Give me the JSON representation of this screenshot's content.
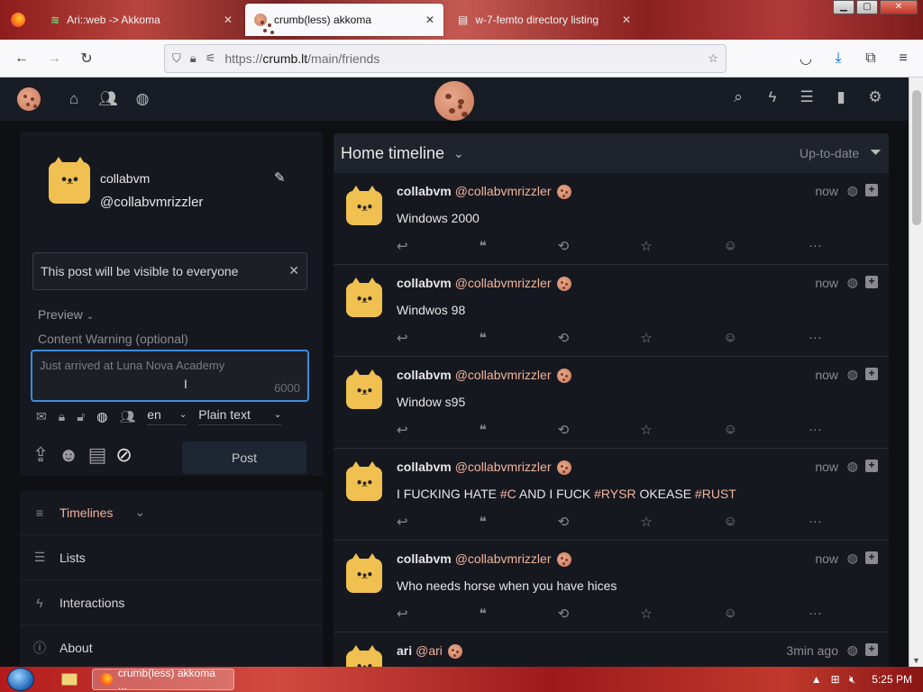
{
  "browser": {
    "tabs": [
      {
        "title": "Ari::web -> Akkoma",
        "active": false
      },
      {
        "title": "crumb(less) akkoma",
        "active": true
      },
      {
        "title": "w-7-femto directory listing",
        "active": false
      }
    ],
    "url": {
      "scheme": "https://",
      "host": "crumb.lt",
      "path": "/main/friends"
    }
  },
  "user": {
    "name": "collabvm",
    "handle": "@collabvmrizzler"
  },
  "composer": {
    "visibility_notice": "This post will be visible to everyone",
    "preview_label": "Preview",
    "cw_placeholder": "Content Warning (optional)",
    "post_placeholder": "Just arrived at Luna Nova Academy",
    "char_count": "6000",
    "language": "en",
    "format": "Plain text",
    "post_button": "Post"
  },
  "menu": {
    "items": [
      {
        "label": "Timelines",
        "icon": "bars-icon",
        "accent": true
      },
      {
        "label": "Lists",
        "icon": "list-icon",
        "accent": false
      },
      {
        "label": "Interactions",
        "icon": "bolt-icon",
        "accent": false
      },
      {
        "label": "About",
        "icon": "info-icon",
        "accent": false
      }
    ]
  },
  "timeline": {
    "title": "Home timeline",
    "status": "Up-to-date",
    "posts": [
      {
        "name": "collabvm",
        "handle": "@collabvmrizzler",
        "time": "now",
        "text": "Windows 2000"
      },
      {
        "name": "collabvm",
        "handle": "@collabvmrizzler",
        "time": "now",
        "text": "Windwos 98"
      },
      {
        "name": "collabvm",
        "handle": "@collabvmrizzler",
        "time": "now",
        "text": "Window s95"
      },
      {
        "name": "collabvm",
        "handle": "@collabvmrizzler",
        "time": "now",
        "text_parts": [
          "I FUCKING HATE ",
          "#C",
          " AND I FUCK ",
          "#RYSR",
          " OKEASE ",
          "#RUST"
        ]
      },
      {
        "name": "collabvm",
        "handle": "@collabvmrizzler",
        "time": "now",
        "text": "Who needs horse when you have hices"
      },
      {
        "name": "ari",
        "handle": "@ari",
        "time": "3min ago",
        "text": ""
      }
    ]
  },
  "taskbar": {
    "active_window": "crumb(less) akkoma ...",
    "clock": "5:25 PM"
  },
  "colors": {
    "accent": "#f2b49a",
    "focus": "#3b8cde",
    "panel": "#161820",
    "avatar": "#f0c050"
  }
}
